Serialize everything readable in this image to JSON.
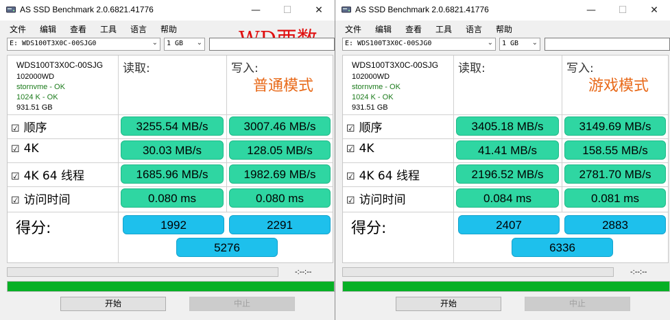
{
  "windows": [
    {
      "title": "AS SSD Benchmark 2.0.6821.41776",
      "menu": [
        "文件",
        "编辑",
        "查看",
        "工具",
        "语言",
        "帮助"
      ],
      "overlay_title": "WD西数",
      "drive": "E: WDS100T3X0C-00SJG0",
      "size": "1 GB",
      "info": {
        "model": "WDS100T3X0C-00SJG",
        "firmware": "102000WD",
        "driver": "stornvme - OK",
        "alignment": "1024 K - OK",
        "capacity": "931.51 GB"
      },
      "read_label": "读取:",
      "write_label": "写入:",
      "mode": "普通模式",
      "rows": [
        {
          "label": "顺序",
          "read": "3255.54 MB/s",
          "write": "3007.46 MB/s"
        },
        {
          "label": "4K",
          "read": "30.03 MB/s",
          "write": "128.05 MB/s"
        },
        {
          "label": "4K 64 线程",
          "read": "1685.96 MB/s",
          "write": "1982.69 MB/s"
        },
        {
          "label": "访问时间",
          "read": "0.080 ms",
          "write": "0.080 ms"
        }
      ],
      "score_label": "得分:",
      "score_read": "1992",
      "score_write": "2291",
      "score_total": "5276",
      "timer": "-:--:--",
      "progress": 1.0,
      "start_label": "开始",
      "stop_label": "中止"
    },
    {
      "title": "AS SSD Benchmark 2.0.6821.41776",
      "menu": [
        "文件",
        "编辑",
        "查看",
        "工具",
        "语言",
        "帮助"
      ],
      "overlay_title": "",
      "drive": "E: WDS100T3X0C-00SJG0",
      "size": "1 GB",
      "info": {
        "model": "WDS100T3X0C-00SJG",
        "firmware": "102000WD",
        "driver": "stornvme - OK",
        "alignment": "1024 K - OK",
        "capacity": "931.51 GB"
      },
      "read_label": "读取:",
      "write_label": "写入:",
      "mode": "游戏模式",
      "rows": [
        {
          "label": "顺序",
          "read": "3405.18 MB/s",
          "write": "3149.69 MB/s"
        },
        {
          "label": "4K",
          "read": "41.41 MB/s",
          "write": "158.55 MB/s"
        },
        {
          "label": "4K 64 线程",
          "read": "2196.52 MB/s",
          "write": "2781.70 MB/s"
        },
        {
          "label": "访问时间",
          "read": "0.084 ms",
          "write": "0.081 ms"
        }
      ],
      "score_label": "得分:",
      "score_read": "2407",
      "score_write": "2883",
      "score_total": "6336",
      "timer": "-:--:--",
      "progress": 1.0,
      "start_label": "开始",
      "stop_label": "中止"
    }
  ],
  "icons": {
    "app": "drive-icon",
    "minimize": "minimize-icon",
    "maximize": "maximize-icon",
    "close": "close-icon",
    "checkbox": "checkbox-checked-icon",
    "dropdown": "chevron-down-icon"
  },
  "colors": {
    "value_fill": "#2fd6a2",
    "score_fill": "#1ec0ec",
    "progress": "#06b025",
    "mode_text": "#e86a1a",
    "overlay_text": "#e01010"
  }
}
